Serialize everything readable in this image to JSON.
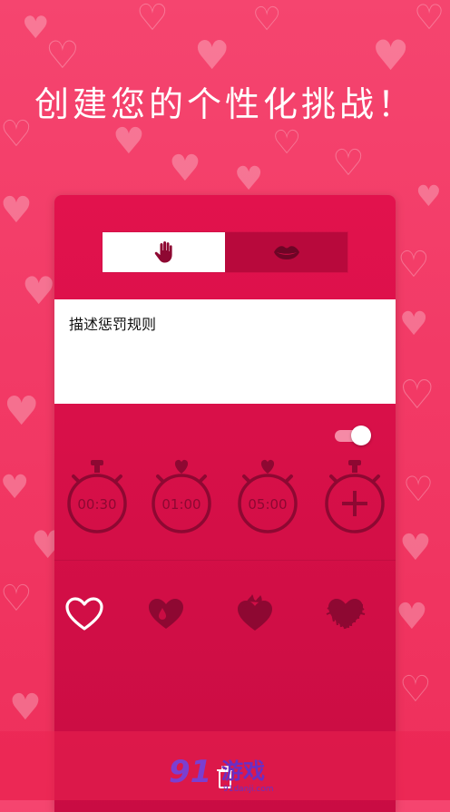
{
  "headline": "创建您的个性化挑战！",
  "mode_toggle": {
    "options": [
      {
        "icon": "hand-icon",
        "selected": true
      },
      {
        "icon": "lips-icon",
        "selected": false
      }
    ]
  },
  "description": {
    "text": "描述惩罚规则"
  },
  "switch": {
    "on": true
  },
  "timers": [
    {
      "label": "00:30",
      "icon": "stopwatch-icon"
    },
    {
      "label": "01:00",
      "icon": "stopwatch-heart-icon"
    },
    {
      "label": "05:00",
      "icon": "stopwatch-heart-icon"
    },
    {
      "label": "",
      "icon": "stopwatch-add-icon"
    }
  ],
  "levels": [
    {
      "icon": "heart-outline-icon",
      "selected": true
    },
    {
      "icon": "heart-drop-icon",
      "selected": false
    },
    {
      "icon": "heart-flame-icon",
      "selected": false
    },
    {
      "icon": "heart-scribble-icon",
      "selected": false
    }
  ],
  "watermark": {
    "logo": "91",
    "brand": "游戏",
    "domain": "91danji.com"
  },
  "colors": {
    "background": "#f23a66",
    "card": "#d40f47",
    "card_dark": "#b8093c",
    "icon_dark": "#8e0832",
    "white": "#ffffff"
  }
}
